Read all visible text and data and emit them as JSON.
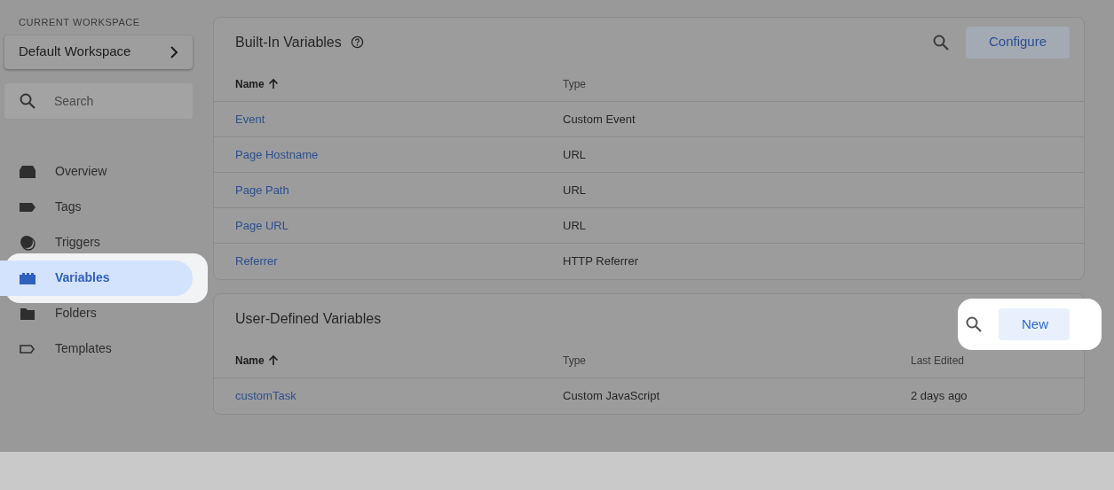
{
  "sidebar": {
    "workspace_label": "CURRENT WORKSPACE",
    "workspace": "Default Workspace",
    "search": {
      "placeholder": "Search"
    },
    "items": [
      {
        "label": "Overview",
        "kind": "overview",
        "selected": false,
        "highlighted": false
      },
      {
        "label": "Tags",
        "kind": "tags",
        "selected": false,
        "highlighted": false
      },
      {
        "label": "Triggers",
        "kind": "triggers",
        "selected": false,
        "highlighted": false
      },
      {
        "label": "Variables",
        "kind": "variables",
        "selected": true,
        "highlighted": true
      },
      {
        "label": "Folders",
        "kind": "folders",
        "selected": false,
        "highlighted": false
      },
      {
        "label": "Templates",
        "kind": "templates",
        "selected": false,
        "highlighted": false
      }
    ]
  },
  "panels": [
    {
      "title": "Built-In Variables",
      "help": true,
      "action": "Configure",
      "highlighted": false,
      "columns": [
        {
          "label": "Name",
          "sorted": true
        },
        {
          "label": "Type",
          "sorted": false
        }
      ],
      "rows": [
        [
          "Event",
          "Custom Event"
        ],
        [
          "Page Hostname",
          "URL"
        ],
        [
          "Page Path",
          "URL"
        ],
        [
          "Page URL",
          "URL"
        ],
        [
          "Referrer",
          "HTTP Referrer"
        ]
      ]
    },
    {
      "title": "User-Defined Variables",
      "help": false,
      "action": "New",
      "highlighted": true,
      "columns": [
        {
          "label": "Name",
          "sorted": true
        },
        {
          "label": "Type",
          "sorted": false
        },
        {
          "label": "Last Edited",
          "sorted": false
        }
      ],
      "rows": [
        [
          "customTask",
          "Custom JavaScript",
          "2 days ago"
        ]
      ]
    }
  ]
}
